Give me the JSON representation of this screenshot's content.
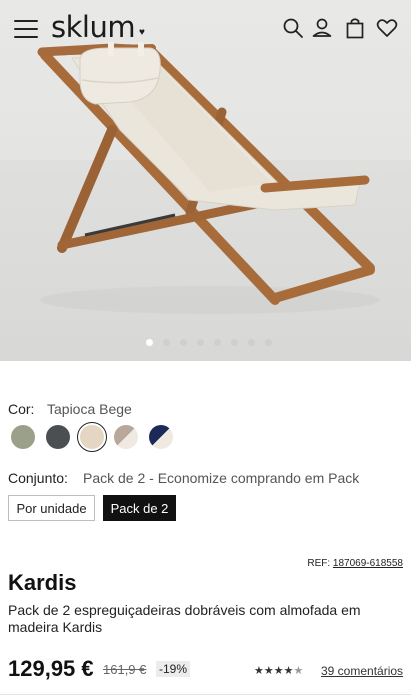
{
  "header": {
    "logo": "sklum",
    "logo_mark": "♥",
    "icons": [
      "menu-icon",
      "search-icon",
      "account-icon",
      "cart-icon",
      "wishlist-icon"
    ]
  },
  "gallery": {
    "image_subject": "folding deckchair with cushion",
    "slide_count": 8,
    "active_slide": 1
  },
  "color": {
    "label": "Cor:",
    "selected": "Tapioca Bege",
    "swatches": [
      {
        "name": "green",
        "color": "#9ba08a"
      },
      {
        "name": "dark-grey",
        "color": "#4b4f52"
      },
      {
        "name": "tapioca-beige",
        "color": "#e4d6c2",
        "selected": true
      },
      {
        "name": "taupe-stripe",
        "color": "#b8a79a"
      },
      {
        "name": "navy-stripe",
        "color": "#1c2a5a"
      }
    ]
  },
  "set": {
    "label": "Conjunto:",
    "selected": "Pack de 2 - Economize comprando em Pack",
    "options": [
      "Por unidade",
      "Pack de 2"
    ]
  },
  "product": {
    "ref_label": "REF:",
    "ref": "187069-618558",
    "name": "Kardis",
    "description": "Pack de 2 espreguiçadeiras dobráveis com almofada em madeira Kardis",
    "price": "129,95 €",
    "old_price": "161,9 €",
    "discount": "-19%",
    "rating_stars": "★★★★★",
    "rating": 4.5,
    "reviews": "39 comentários"
  }
}
